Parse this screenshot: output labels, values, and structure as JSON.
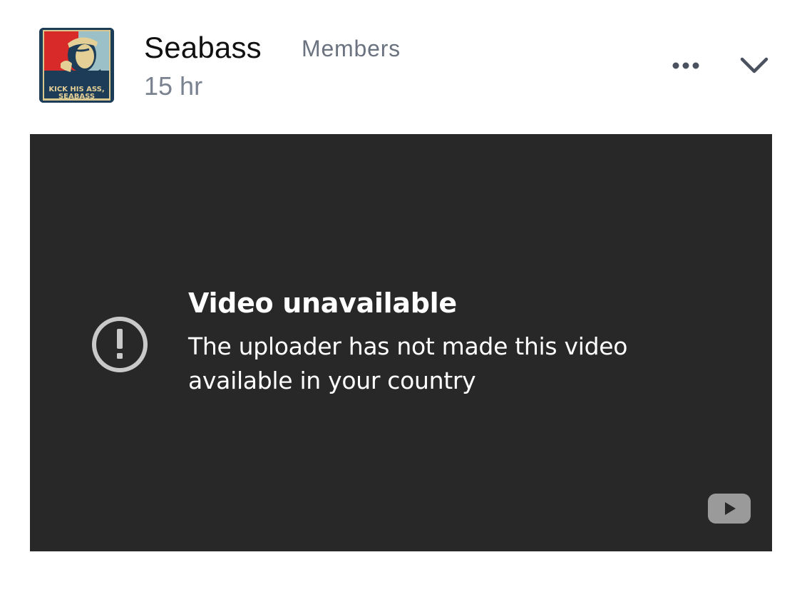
{
  "post": {
    "author": "Seabass",
    "group": "Members",
    "time": "15 hr",
    "avatar_caption_line1": "KICK HIS ASS,",
    "avatar_caption_line2": "SEABASS",
    "icons": {
      "more": "more-horizontal-icon",
      "collapse": "chevron-down-icon"
    }
  },
  "video": {
    "title": "Video unavailable",
    "message": "The uploader has not made this video available in your country",
    "icons": {
      "warning": "exclamation-circle-icon",
      "brand": "youtube-logo-icon"
    }
  },
  "colors": {
    "video_bg": "#282828",
    "secondary_text": "#6b7380",
    "icon_gray": "#4a5260"
  }
}
